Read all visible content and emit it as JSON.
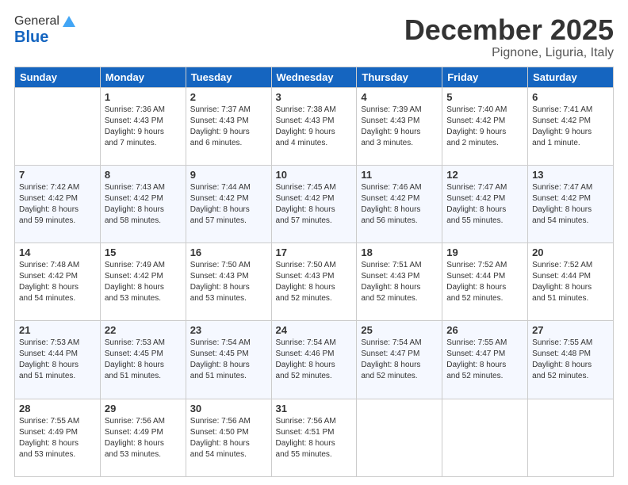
{
  "header": {
    "logo_general": "General",
    "logo_blue": "Blue",
    "month_title": "December 2025",
    "location": "Pignone, Liguria, Italy"
  },
  "days_of_week": [
    "Sunday",
    "Monday",
    "Tuesday",
    "Wednesday",
    "Thursday",
    "Friday",
    "Saturday"
  ],
  "weeks": [
    [
      {
        "day": "",
        "info": ""
      },
      {
        "day": "1",
        "info": "Sunrise: 7:36 AM\nSunset: 4:43 PM\nDaylight: 9 hours\nand 7 minutes."
      },
      {
        "day": "2",
        "info": "Sunrise: 7:37 AM\nSunset: 4:43 PM\nDaylight: 9 hours\nand 6 minutes."
      },
      {
        "day": "3",
        "info": "Sunrise: 7:38 AM\nSunset: 4:43 PM\nDaylight: 9 hours\nand 4 minutes."
      },
      {
        "day": "4",
        "info": "Sunrise: 7:39 AM\nSunset: 4:43 PM\nDaylight: 9 hours\nand 3 minutes."
      },
      {
        "day": "5",
        "info": "Sunrise: 7:40 AM\nSunset: 4:42 PM\nDaylight: 9 hours\nand 2 minutes."
      },
      {
        "day": "6",
        "info": "Sunrise: 7:41 AM\nSunset: 4:42 PM\nDaylight: 9 hours\nand 1 minute."
      }
    ],
    [
      {
        "day": "7",
        "info": "Sunrise: 7:42 AM\nSunset: 4:42 PM\nDaylight: 8 hours\nand 59 minutes."
      },
      {
        "day": "8",
        "info": "Sunrise: 7:43 AM\nSunset: 4:42 PM\nDaylight: 8 hours\nand 58 minutes."
      },
      {
        "day": "9",
        "info": "Sunrise: 7:44 AM\nSunset: 4:42 PM\nDaylight: 8 hours\nand 57 minutes."
      },
      {
        "day": "10",
        "info": "Sunrise: 7:45 AM\nSunset: 4:42 PM\nDaylight: 8 hours\nand 57 minutes."
      },
      {
        "day": "11",
        "info": "Sunrise: 7:46 AM\nSunset: 4:42 PM\nDaylight: 8 hours\nand 56 minutes."
      },
      {
        "day": "12",
        "info": "Sunrise: 7:47 AM\nSunset: 4:42 PM\nDaylight: 8 hours\nand 55 minutes."
      },
      {
        "day": "13",
        "info": "Sunrise: 7:47 AM\nSunset: 4:42 PM\nDaylight: 8 hours\nand 54 minutes."
      }
    ],
    [
      {
        "day": "14",
        "info": "Sunrise: 7:48 AM\nSunset: 4:42 PM\nDaylight: 8 hours\nand 54 minutes."
      },
      {
        "day": "15",
        "info": "Sunrise: 7:49 AM\nSunset: 4:42 PM\nDaylight: 8 hours\nand 53 minutes."
      },
      {
        "day": "16",
        "info": "Sunrise: 7:50 AM\nSunset: 4:43 PM\nDaylight: 8 hours\nand 53 minutes."
      },
      {
        "day": "17",
        "info": "Sunrise: 7:50 AM\nSunset: 4:43 PM\nDaylight: 8 hours\nand 52 minutes."
      },
      {
        "day": "18",
        "info": "Sunrise: 7:51 AM\nSunset: 4:43 PM\nDaylight: 8 hours\nand 52 minutes."
      },
      {
        "day": "19",
        "info": "Sunrise: 7:52 AM\nSunset: 4:44 PM\nDaylight: 8 hours\nand 52 minutes."
      },
      {
        "day": "20",
        "info": "Sunrise: 7:52 AM\nSunset: 4:44 PM\nDaylight: 8 hours\nand 51 minutes."
      }
    ],
    [
      {
        "day": "21",
        "info": "Sunrise: 7:53 AM\nSunset: 4:44 PM\nDaylight: 8 hours\nand 51 minutes."
      },
      {
        "day": "22",
        "info": "Sunrise: 7:53 AM\nSunset: 4:45 PM\nDaylight: 8 hours\nand 51 minutes."
      },
      {
        "day": "23",
        "info": "Sunrise: 7:54 AM\nSunset: 4:45 PM\nDaylight: 8 hours\nand 51 minutes."
      },
      {
        "day": "24",
        "info": "Sunrise: 7:54 AM\nSunset: 4:46 PM\nDaylight: 8 hours\nand 52 minutes."
      },
      {
        "day": "25",
        "info": "Sunrise: 7:54 AM\nSunset: 4:47 PM\nDaylight: 8 hours\nand 52 minutes."
      },
      {
        "day": "26",
        "info": "Sunrise: 7:55 AM\nSunset: 4:47 PM\nDaylight: 8 hours\nand 52 minutes."
      },
      {
        "day": "27",
        "info": "Sunrise: 7:55 AM\nSunset: 4:48 PM\nDaylight: 8 hours\nand 52 minutes."
      }
    ],
    [
      {
        "day": "28",
        "info": "Sunrise: 7:55 AM\nSunset: 4:49 PM\nDaylight: 8 hours\nand 53 minutes."
      },
      {
        "day": "29",
        "info": "Sunrise: 7:56 AM\nSunset: 4:49 PM\nDaylight: 8 hours\nand 53 minutes."
      },
      {
        "day": "30",
        "info": "Sunrise: 7:56 AM\nSunset: 4:50 PM\nDaylight: 8 hours\nand 54 minutes."
      },
      {
        "day": "31",
        "info": "Sunrise: 7:56 AM\nSunset: 4:51 PM\nDaylight: 8 hours\nand 55 minutes."
      },
      {
        "day": "",
        "info": ""
      },
      {
        "day": "",
        "info": ""
      },
      {
        "day": "",
        "info": ""
      }
    ]
  ]
}
